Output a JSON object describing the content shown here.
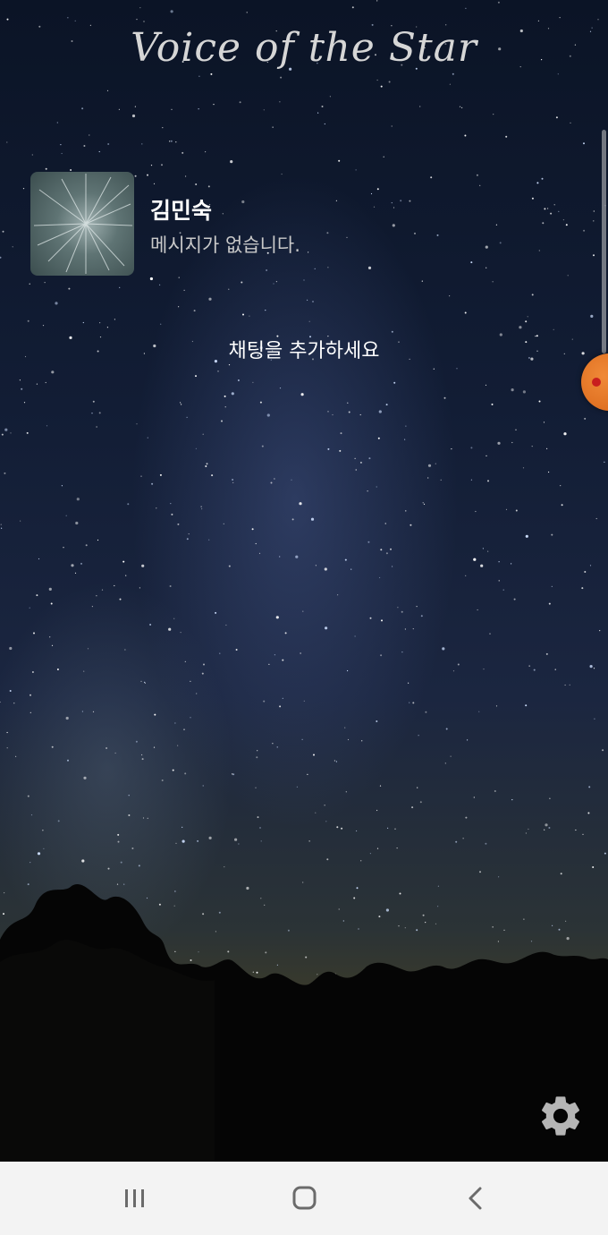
{
  "app": {
    "title": "Voice of the Star"
  },
  "chat_list": {
    "items": [
      {
        "name": "김민숙",
        "preview": "메시지가 없습니다.",
        "avatar_icon": "starfield-avatar"
      }
    ],
    "add_hint": "채팅을 추가하세요"
  },
  "settings": {
    "icon": "gear-icon"
  },
  "navigation_bar": {
    "buttons": [
      {
        "icon": "recents-icon"
      },
      {
        "icon": "home-icon"
      },
      {
        "icon": "back-icon"
      }
    ]
  },
  "colors": {
    "title_text": "#d6d6d6",
    "name_text": "#ffffff",
    "preview_text": "#c9c9c9",
    "nav_bar_background": "#f3f3f3",
    "nav_icon": "#6b6b6b",
    "floating_bubble": "#e0711f"
  }
}
